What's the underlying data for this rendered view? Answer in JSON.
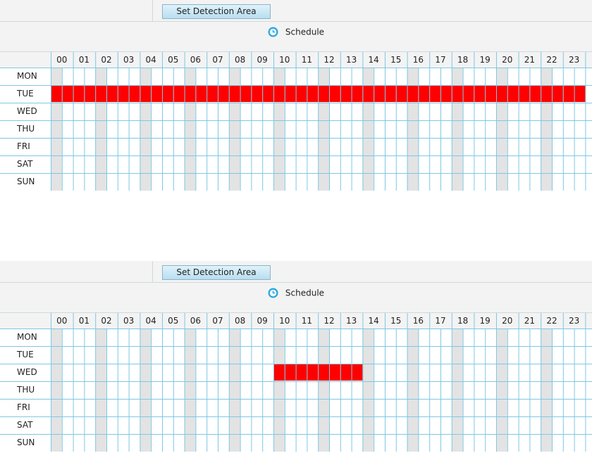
{
  "panels": [
    {
      "button_label": "Set Detection Area",
      "schedule_title": "Schedule",
      "hours": [
        "00",
        "01",
        "02",
        "03",
        "04",
        "05",
        "06",
        "07",
        "08",
        "09",
        "10",
        "11",
        "12",
        "13",
        "14",
        "15",
        "16",
        "17",
        "18",
        "19",
        "20",
        "21",
        "22",
        "23"
      ],
      "days": [
        "MON",
        "TUE",
        "WED",
        "THU",
        "FRI",
        "SAT",
        "SUN"
      ],
      "selected": [
        {
          "day": "TUE",
          "from_hour": 0,
          "to_hour": 24
        }
      ]
    },
    {
      "button_label": "Set Detection Area",
      "schedule_title": "Schedule",
      "hours": [
        "00",
        "01",
        "02",
        "03",
        "04",
        "05",
        "06",
        "07",
        "08",
        "09",
        "10",
        "11",
        "12",
        "13",
        "14",
        "15",
        "16",
        "17",
        "18",
        "19",
        "20",
        "21",
        "22",
        "23"
      ],
      "days": [
        "MON",
        "TUE",
        "WED",
        "THU",
        "FRI",
        "SAT",
        "SUN"
      ],
      "selected": [
        {
          "day": "WED",
          "from_hour": 10,
          "to_hour": 14
        }
      ]
    }
  ],
  "colors": {
    "selected": "#ff0000",
    "grid_line": "#7ec8e3",
    "shaded_column": "#e3e3e3",
    "header_bg": "#f3f3f3"
  },
  "icons": {
    "schedule": "clock-icon"
  }
}
